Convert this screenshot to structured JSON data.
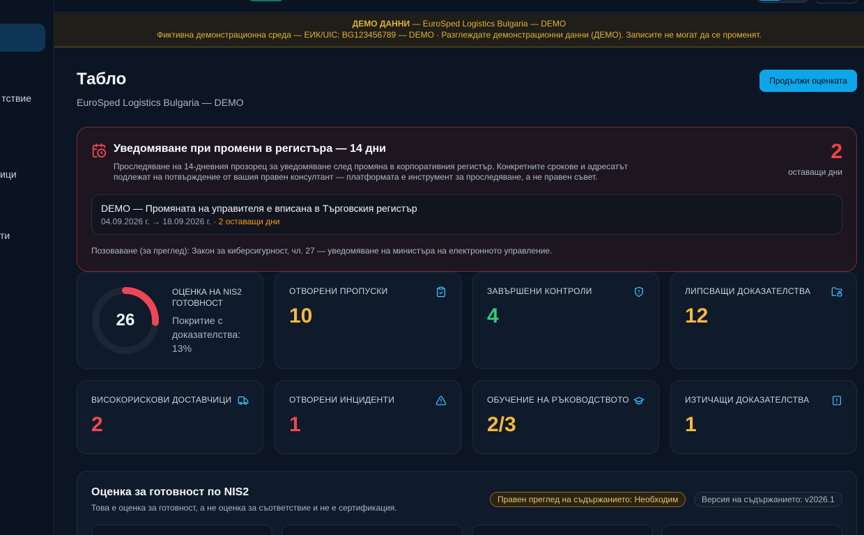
{
  "sidebar": {
    "items": [
      {
        "label": ""
      },
      {
        "label": "тствие"
      },
      {
        "label": "ици"
      },
      {
        "label": "ти"
      }
    ]
  },
  "banner": {
    "strong": "ДЕМО ДАННИ",
    "line1_rest": " — EuroSped Logistics Bulgaria — DEMO",
    "line2": "Фиктивна демонстрационна среда — ЕИК/UIC: BG123456789 — DEMO · Разглеждате демонстрационни данни (ДЕМО). Записите не могат да се променят."
  },
  "header": {
    "title": "Табло",
    "subtitle": "EuroSped Logistics Bulgaria — DEMO",
    "continue_label": "Продължи оценката"
  },
  "alert": {
    "title": "Уведомяване при промени в регистъра — 14 дни",
    "description": "Проследяване на 14-дневния прозорец за уведомяване след промяна в корпоративния регистър. Конкретните срокове и адресатът подлежат на потвърждение от вашия правен консултант — платформата е инструмент за проследяване, а не правен съвет.",
    "count": "2",
    "count_label": "оставащи дни",
    "item": {
      "title": "DEMO — Промяната на управителя е вписана в Търговския регистър",
      "dates": "04.09.2026 г. → 18.09.2026 г. · ",
      "remaining": "2 оставащи дни"
    },
    "legal": "Позоваване (за преглед): Закон за киберсигурност, чл. 27 — уведомяване на министъра на електронното управление."
  },
  "score": {
    "value": "26",
    "percent": 26,
    "label": "Оценка на NIS2 готовност",
    "coverage": "Покритие с доказателства: 13%"
  },
  "stats": [
    {
      "label": "Отворени пропуски",
      "value": "10",
      "icon": "clipboard-check-icon"
    },
    {
      "label": "Завършени контроли",
      "value": "4",
      "icon": "shield-icon"
    },
    {
      "label": "Липсващи доказателства",
      "value": "12",
      "icon": "folder-lock-icon"
    },
    {
      "label": "Високорискови доставчици",
      "value": "2",
      "icon": "truck-icon"
    },
    {
      "label": "Отворени инциденти",
      "value": "1",
      "icon": "warning-triangle-icon"
    },
    {
      "label": "Обучение на ръководството",
      "value": "2/3",
      "icon": "graduation-cap-icon"
    },
    {
      "label": "Изтичащи доказателства",
      "value": "1",
      "icon": "alert-file-icon"
    }
  ],
  "assessment": {
    "title": "Оценка за готовност по NIS2",
    "subtitle": "Това е оценка за готовност, а не оценка за съответствие и не е сертификация.",
    "badge_legal": "Правен преглед на съдържанието: Необходим",
    "badge_version": "Версия на съдържанието: v2026.1"
  },
  "colors": {
    "accent": "#0ea5e9",
    "danger": "#ef4655",
    "warning": "#f5b740",
    "success": "#34c77b",
    "background": "#0b1524"
  }
}
